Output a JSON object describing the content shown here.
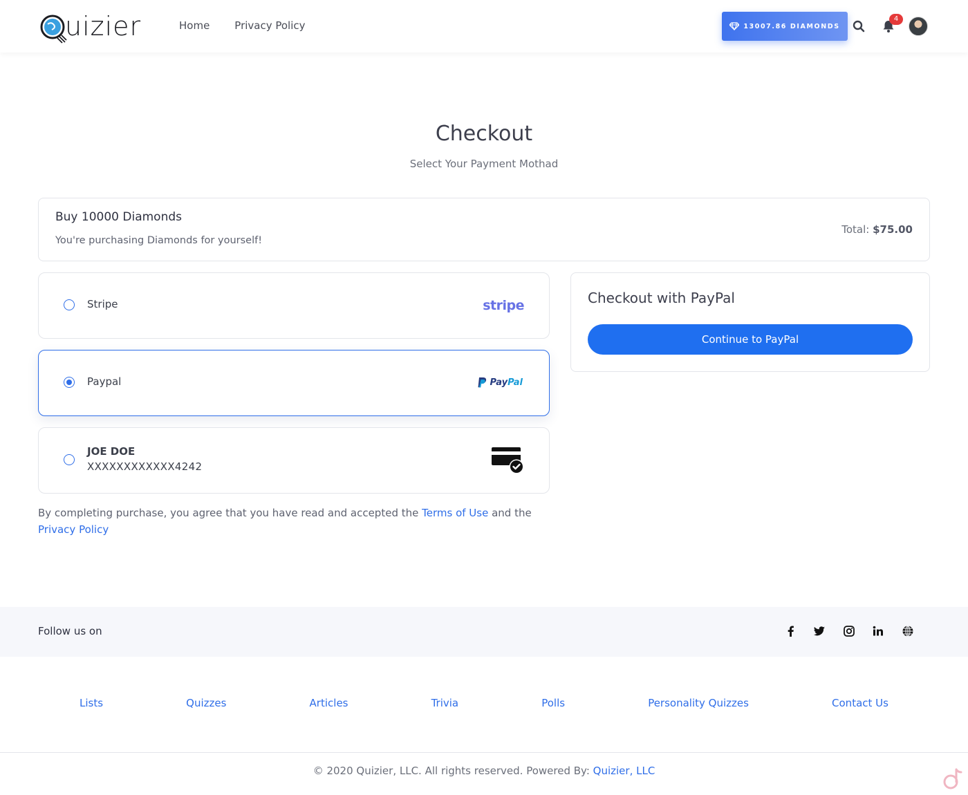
{
  "header": {
    "logo_text": "uizier",
    "nav": [
      {
        "label": "Home"
      },
      {
        "label": "Privacy Policy"
      }
    ],
    "diamonds_label": "13007.86 DIAMONDS",
    "notification_count": "4",
    "colors": {
      "accent": "#3f73ee",
      "badge": "#e53a3a"
    }
  },
  "page": {
    "title": "Checkout",
    "subtitle": "Select Your Payment Mothad"
  },
  "summary": {
    "title": "Buy 10000 Diamonds",
    "subtitle": "You're purchasing Diamonds for yourself!",
    "total_label": "Total:",
    "total_value": "$75.00"
  },
  "payment_options": [
    {
      "label": "Stripe",
      "logo_text": "stripe",
      "selected": false
    },
    {
      "label": "Paypal",
      "logo_text_1": "Pay",
      "logo_text_2": "Pal",
      "selected": true
    },
    {
      "name": "JOE DOE",
      "number": "XXXXXXXXXXXX4242",
      "selected": false
    }
  ],
  "terms": {
    "prefix": "By completing purchase, you agree that you have read and accepted the ",
    "terms_link": "Terms of Use",
    "middle": " and the ",
    "privacy_link": "Privacy Policy"
  },
  "checkout": {
    "title": "Checkout with PayPal",
    "button_label": "Continue to PayPal"
  },
  "follow": {
    "label": "Follow us on",
    "icons": [
      "facebook-icon",
      "twitter-icon",
      "instagram-icon",
      "linkedin-icon",
      "globe-icon"
    ]
  },
  "footer": {
    "links": [
      "Lists",
      "Quizzes",
      "Articles",
      "Trivia",
      "Polls",
      "Personality Quizzes",
      "Contact Us"
    ],
    "copyright": "© 2020 Quizier, LLC. All rights reserved. Powered By: ",
    "powered_link": "Quizier, LLC"
  }
}
